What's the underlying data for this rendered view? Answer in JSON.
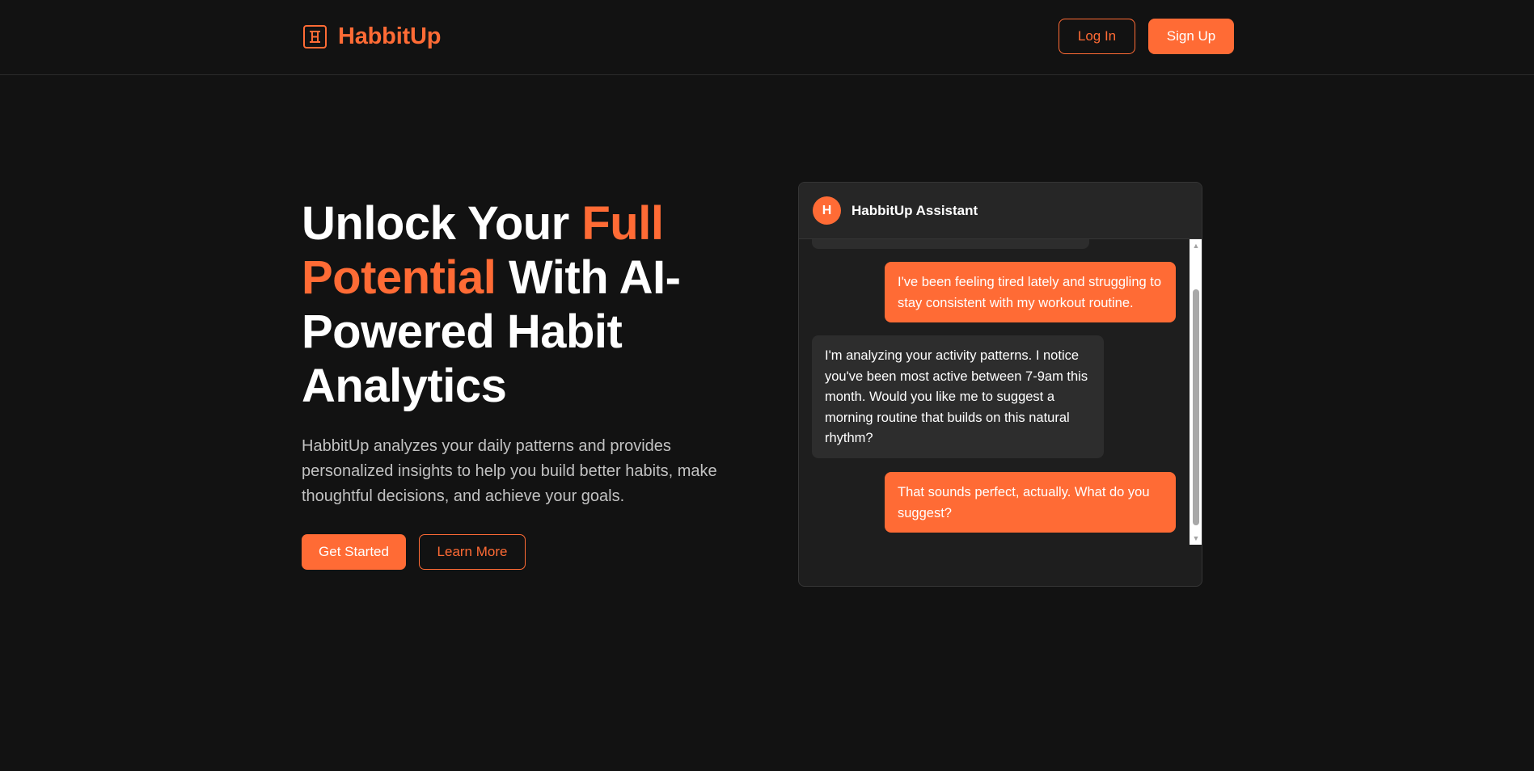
{
  "header": {
    "brand": "HabbitUp",
    "login_label": "Log In",
    "signup_label": "Sign Up"
  },
  "hero": {
    "title_part1": "Unlock Your ",
    "title_accent": "Full Potential",
    "title_part2": " With AI-Powered Habit Analytics",
    "description": "HabbitUp analyzes your daily patterns and provides personalized insights to help you build better habits, make thoughtful decisions, and achieve your goals.",
    "primary_cta": "Get Started",
    "secondary_cta": "Learn More"
  },
  "chat": {
    "avatar_letter": "H",
    "title": "HabbitUp Assistant",
    "messages": [
      {
        "role": "user",
        "text": "I've been feeling tired lately and struggling to stay consistent with my workout routine."
      },
      {
        "role": "assistant",
        "text": "I'm analyzing your activity patterns. I notice you've been most active between 7-9am this month. Would you like me to suggest a morning routine that builds on this natural rhythm?"
      },
      {
        "role": "user",
        "text": "That sounds perfect, actually. What do you suggest?"
      }
    ]
  },
  "colors": {
    "background": "#121212",
    "accent": "#ff6b35",
    "card": "#1e1e1e",
    "bubble_bot": "#2d2d2d",
    "text_muted": "#c2c2c2"
  },
  "icons": {
    "logo": "habit-logo-icon",
    "scroll_up": "scroll-up-arrow-icon",
    "scroll_down": "scroll-down-arrow-icon"
  }
}
